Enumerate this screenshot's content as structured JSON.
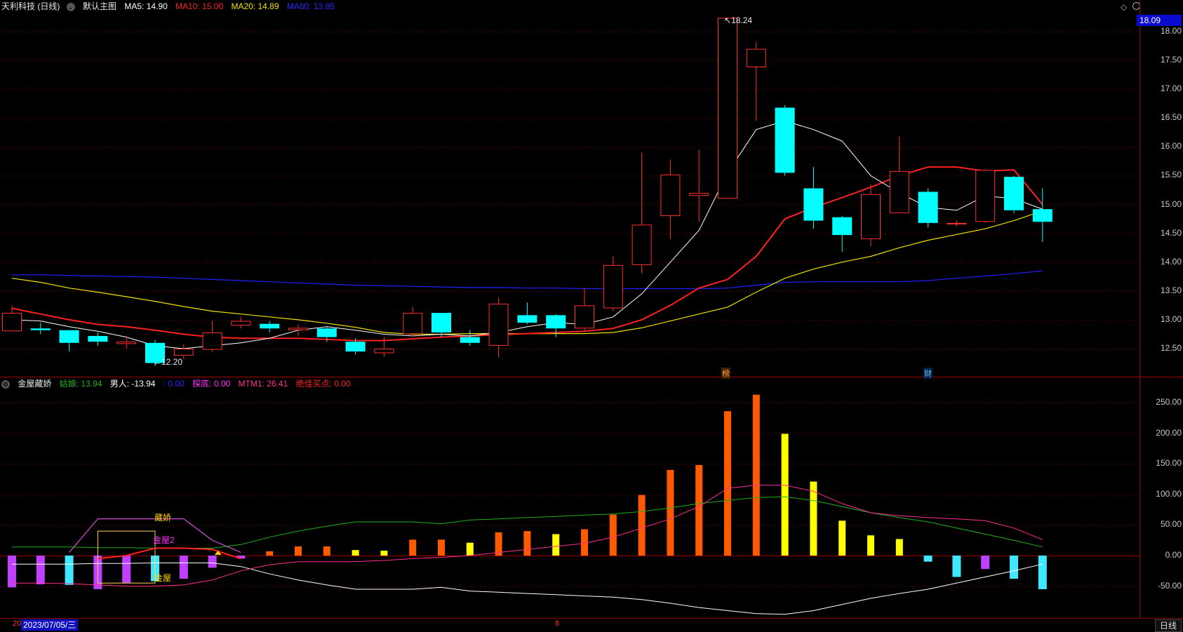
{
  "header": {
    "stock": "天利科技 (日线)",
    "main_chart": "默认主图",
    "ma5": "MA5: 14.90",
    "ma10": "MA10: 15.00",
    "ma20": "MA20: 14.89",
    "ma60": "MA60: 13.85",
    "colors": {
      "ma5": "#ffffff",
      "ma10": "#ff2020",
      "ma20": "#f0e000",
      "ma60": "#2020ff"
    }
  },
  "price_axis": {
    "current": "18.09",
    "ticks": [
      "18.00",
      "17.50",
      "17.00",
      "16.50",
      "16.00",
      "15.50",
      "15.00",
      "14.50",
      "14.00",
      "13.50",
      "13.00",
      "12.50"
    ]
  },
  "annotations": {
    "high": "18.24",
    "low": "12.20",
    "tag1": "榜",
    "tag2": "财"
  },
  "indicator_header": {
    "name": "金屋藏娇",
    "girl": "姑娘: 13.94",
    "man": "男人: -13.94",
    "blank": ": 0.00",
    "explore": "探底: 0.00",
    "mtm": "MTM1: 26.41",
    "best_buy": "绝佳买点: 0.00"
  },
  "indicator_axis": {
    "ticks": [
      "250.00",
      "200.00",
      "150.00",
      "100.00",
      "50.00",
      "0.00",
      "-50.00"
    ]
  },
  "indicator_labels": {
    "zangjiao": "藏娇",
    "jinwu2": "金屋2",
    "jinwu": "金屋"
  },
  "footer": {
    "date": "2023/07/05/三",
    "left_mark": "20",
    "mid_mark": "8",
    "period": "日线"
  },
  "chart_data": [
    {
      "type": "candlestick",
      "ylim": [
        12.0,
        18.25
      ],
      "candles": [
        {
          "o": 12.8,
          "c": 13.12,
          "h": 13.25,
          "l": 12.8
        },
        {
          "o": 12.85,
          "c": 12.82,
          "h": 12.95,
          "l": 12.75
        },
        {
          "o": 12.82,
          "c": 12.6,
          "h": 12.82,
          "l": 12.45
        },
        {
          "o": 12.72,
          "c": 12.62,
          "h": 12.78,
          "l": 12.55
        },
        {
          "o": 12.58,
          "c": 12.62,
          "h": 12.72,
          "l": 12.5
        },
        {
          "o": 12.6,
          "c": 12.25,
          "h": 12.65,
          "l": 12.2
        },
        {
          "o": 12.38,
          "c": 12.5,
          "h": 12.58,
          "l": 12.32
        },
        {
          "o": 12.48,
          "c": 12.78,
          "h": 12.98,
          "l": 12.45
        },
        {
          "o": 12.9,
          "c": 12.98,
          "h": 13.05,
          "l": 12.85
        },
        {
          "o": 12.93,
          "c": 12.85,
          "h": 12.98,
          "l": 12.78
        },
        {
          "o": 12.82,
          "c": 12.86,
          "h": 12.92,
          "l": 12.72
        },
        {
          "o": 12.85,
          "c": 12.7,
          "h": 12.88,
          "l": 12.62
        },
        {
          "o": 12.62,
          "c": 12.45,
          "h": 12.68,
          "l": 12.4
        },
        {
          "o": 12.42,
          "c": 12.5,
          "h": 12.7,
          "l": 12.36
        },
        {
          "o": 12.75,
          "c": 13.12,
          "h": 13.22,
          "l": 12.72
        },
        {
          "o": 13.12,
          "c": 12.78,
          "h": 13.12,
          "l": 12.7
        },
        {
          "o": 12.7,
          "c": 12.6,
          "h": 12.82,
          "l": 12.55
        },
        {
          "o": 12.55,
          "c": 13.28,
          "h": 13.38,
          "l": 12.35
        },
        {
          "o": 13.08,
          "c": 12.95,
          "h": 13.3,
          "l": 12.92
        },
        {
          "o": 13.08,
          "c": 12.85,
          "h": 13.1,
          "l": 12.7
        },
        {
          "o": 12.85,
          "c": 13.25,
          "h": 13.55,
          "l": 12.8
        },
        {
          "o": 13.2,
          "c": 13.95,
          "h": 14.1,
          "l": 13.15
        },
        {
          "o": 13.95,
          "c": 14.65,
          "h": 15.9,
          "l": 13.8
        },
        {
          "o": 14.8,
          "c": 15.52,
          "h": 15.78,
          "l": 14.4
        },
        {
          "o": 15.15,
          "c": 15.2,
          "h": 15.95,
          "l": 14.7
        },
        {
          "o": 15.1,
          "c": 18.24,
          "h": 18.24,
          "l": 15.1
        },
        {
          "o": 17.38,
          "c": 17.7,
          "h": 17.82,
          "l": 16.45
        },
        {
          "o": 16.68,
          "c": 15.55,
          "h": 16.72,
          "l": 15.5
        },
        {
          "o": 15.28,
          "c": 14.72,
          "h": 15.65,
          "l": 14.58
        },
        {
          "o": 14.78,
          "c": 14.47,
          "h": 14.8,
          "l": 14.18
        },
        {
          "o": 14.4,
          "c": 15.18,
          "h": 15.35,
          "l": 14.28
        },
        {
          "o": 14.85,
          "c": 15.58,
          "h": 16.18,
          "l": 14.85
        },
        {
          "o": 15.22,
          "c": 14.68,
          "h": 15.28,
          "l": 14.6
        },
        {
          "o": 14.68,
          "c": 14.68,
          "h": 14.72,
          "l": 14.62
        },
        {
          "o": 14.7,
          "c": 15.6,
          "h": 15.62,
          "l": 14.68
        },
        {
          "o": 15.48,
          "c": 14.9,
          "h": 15.5,
          "l": 14.85
        },
        {
          "o": 14.92,
          "c": 14.7,
          "h": 15.28,
          "l": 14.35
        }
      ],
      "ma5": [
        13.0,
        12.98,
        12.88,
        12.8,
        12.7,
        12.55,
        12.5,
        12.55,
        12.6,
        12.68,
        12.82,
        12.88,
        12.82,
        12.75,
        12.72,
        12.75,
        12.72,
        12.78,
        12.88,
        12.95,
        12.92,
        13.05,
        13.45,
        14.0,
        14.55,
        15.55,
        16.3,
        16.45,
        16.3,
        16.1,
        15.5,
        15.2,
        14.95,
        14.9,
        15.15,
        15.1,
        14.92
      ],
      "ma10": [
        13.2,
        13.1,
        13.0,
        12.92,
        12.88,
        12.82,
        12.75,
        12.7,
        12.68,
        12.68,
        12.68,
        12.66,
        12.64,
        12.64,
        12.67,
        12.7,
        12.72,
        12.74,
        12.76,
        12.78,
        12.8,
        12.85,
        13.0,
        13.25,
        13.55,
        13.7,
        14.1,
        14.75,
        14.95,
        15.12,
        15.3,
        15.5,
        15.65,
        15.65,
        15.58,
        15.6,
        15.0
      ],
      "ma20": [
        13.72,
        13.65,
        13.55,
        13.48,
        13.4,
        13.32,
        13.23,
        13.15,
        13.1,
        13.05,
        13.0,
        12.94,
        12.87,
        12.78,
        12.75,
        12.75,
        12.76,
        12.76,
        12.76,
        12.76,
        12.76,
        12.78,
        12.86,
        12.98,
        13.1,
        13.22,
        13.48,
        13.72,
        13.88,
        14.0,
        14.1,
        14.25,
        14.38,
        14.48,
        14.58,
        14.72,
        14.89
      ],
      "ma60": [
        13.78,
        13.78,
        13.77,
        13.76,
        13.75,
        13.74,
        13.72,
        13.7,
        13.68,
        13.66,
        13.64,
        13.62,
        13.6,
        13.59,
        13.58,
        13.57,
        13.56,
        13.56,
        13.55,
        13.55,
        13.54,
        13.54,
        13.54,
        13.54,
        13.54,
        13.55,
        13.6,
        13.65,
        13.66,
        13.66,
        13.66,
        13.66,
        13.68,
        13.72,
        13.76,
        13.8,
        13.85
      ]
    },
    {
      "type": "bar",
      "ylim": [
        -75,
        280
      ],
      "bars": [
        -52,
        -47,
        -48,
        -55,
        -45,
        -42,
        -38,
        -20,
        -5,
        7,
        15,
        15,
        9,
        8,
        26,
        26,
        21,
        38,
        40,
        35,
        43,
        67,
        99,
        140,
        148,
        236,
        263,
        199,
        121,
        57,
        33,
        27,
        -10,
        -35,
        -22,
        -38,
        -55
      ],
      "bar_colors": [
        "#c040ff",
        "#c040ff",
        "#40e8ff",
        "#c040ff",
        "#c040ff",
        "#40e8ff",
        "#c040ff",
        "#c040ff",
        "#c040ff",
        "#ff5a00",
        "#ff5a00",
        "#ff5a00",
        "#ffff00",
        "#ffff00",
        "#ff5a00",
        "#ff5a00",
        "#ffff00",
        "#ff5a00",
        "#ff5a00",
        "#ffff00",
        "#ff5a00",
        "#ff5a00",
        "#ff5a00",
        "#ff5a00",
        "#ff5a00",
        "#ff5a00",
        "#ff5a00",
        "#ffff00",
        "#ffff00",
        "#ffff00",
        "#ffff00",
        "#ffff00",
        "#40e8ff",
        "#40e8ff",
        "#c040ff",
        "#40e8ff",
        "#40e8ff"
      ],
      "series": [
        {
          "name": "姑娘",
          "color": "#20b020",
          "values": [
            14,
            14,
            14,
            13,
            13,
            12,
            12,
            12,
            18,
            30,
            40,
            48,
            55,
            55,
            55,
            52,
            58,
            60,
            62,
            64,
            66,
            68,
            72,
            78,
            85,
            90,
            95,
            96,
            90,
            80,
            70,
            62,
            55,
            45,
            35,
            25,
            14
          ]
        },
        {
          "name": "男人",
          "color": "#ffffff",
          "values": [
            -14,
            -14,
            -14,
            -13,
            -13,
            -12,
            -12,
            -12,
            -18,
            -30,
            -40,
            -48,
            -55,
            -55,
            -55,
            -52,
            -58,
            -60,
            -62,
            -64,
            -66,
            -68,
            -72,
            -78,
            -85,
            -90,
            -95,
            -96,
            -90,
            -80,
            -70,
            -62,
            -55,
            -45,
            -35,
            -25,
            -14
          ]
        },
        {
          "name": "MTM1",
          "color": "#ff3090",
          "values": [
            -45,
            -45,
            -46,
            -48,
            -50,
            -50,
            -48,
            -40,
            -25,
            -15,
            -10,
            -10,
            -10,
            -8,
            -5,
            -3,
            0,
            5,
            10,
            15,
            20,
            30,
            45,
            60,
            80,
            110,
            115,
            115,
            105,
            85,
            70,
            65,
            62,
            60,
            57,
            45,
            26
          ]
        }
      ],
      "zone_lines": {
        "color": "#ff60ff",
        "points": [
          [
            2,
            5
          ],
          [
            3,
            60
          ],
          [
            6,
            60
          ],
          [
            7,
            25
          ],
          [
            8,
            5
          ]
        ]
      },
      "box": {
        "x0": 3,
        "x1": 5,
        "y0": 40,
        "y1": -45,
        "color": "#ffd060"
      },
      "red_segment": {
        "color": "#ff2020",
        "points": [
          [
            3,
            -5
          ],
          [
            4,
            0
          ],
          [
            5,
            12
          ],
          [
            6,
            12
          ],
          [
            7,
            10
          ],
          [
            8,
            -5
          ]
        ]
      }
    }
  ]
}
